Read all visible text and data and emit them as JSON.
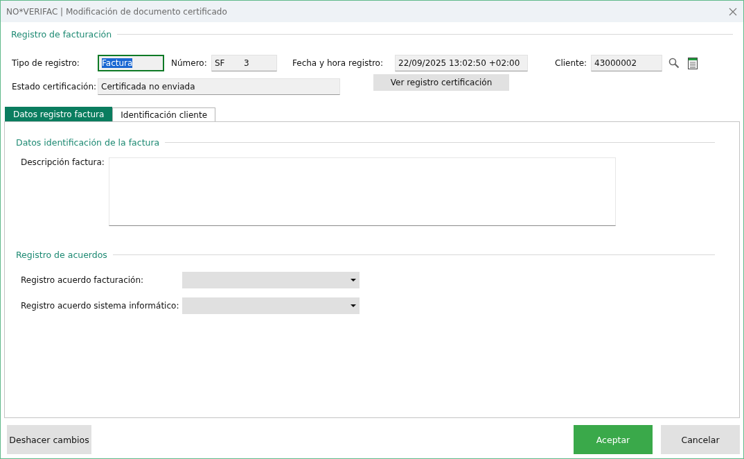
{
  "window": {
    "title": "NO*VERIFAC | Modificación de documento certificado"
  },
  "registro": {
    "title": "Registro de facturación",
    "tipo": {
      "label": "Tipo de registro:",
      "value": "Factura",
      "focused": true
    },
    "numero": {
      "label": "Número:",
      "series": "SF",
      "value": "3"
    },
    "fecha": {
      "label": "Fecha y hora registro:",
      "value": "22/09/2025 13:02:50 +02:00"
    },
    "cliente": {
      "label": "Cliente:",
      "value": "43000002"
    },
    "estado": {
      "label": "Estado certificación:",
      "value": "Certificada no enviada"
    },
    "ver_button": "Ver registro certificación"
  },
  "tabs": [
    {
      "label": "Datos registro factura",
      "selected": true
    },
    {
      "label": "Identificación cliente",
      "selected": false
    }
  ],
  "identificacion": {
    "title": "Datos identificación de la factura",
    "descripcion_label": "Descripción factura:"
  },
  "acuerdos": {
    "title": "Registro de acuerdos",
    "dropdowns": [
      {
        "label": "Registro acuerdo facturación:"
      },
      {
        "label": "Registro acuerdo sistema informático:"
      }
    ]
  },
  "buttons": {
    "undo": "Deshacer cambios",
    "accept": "Aceptar",
    "cancel": "Cancelar"
  }
}
